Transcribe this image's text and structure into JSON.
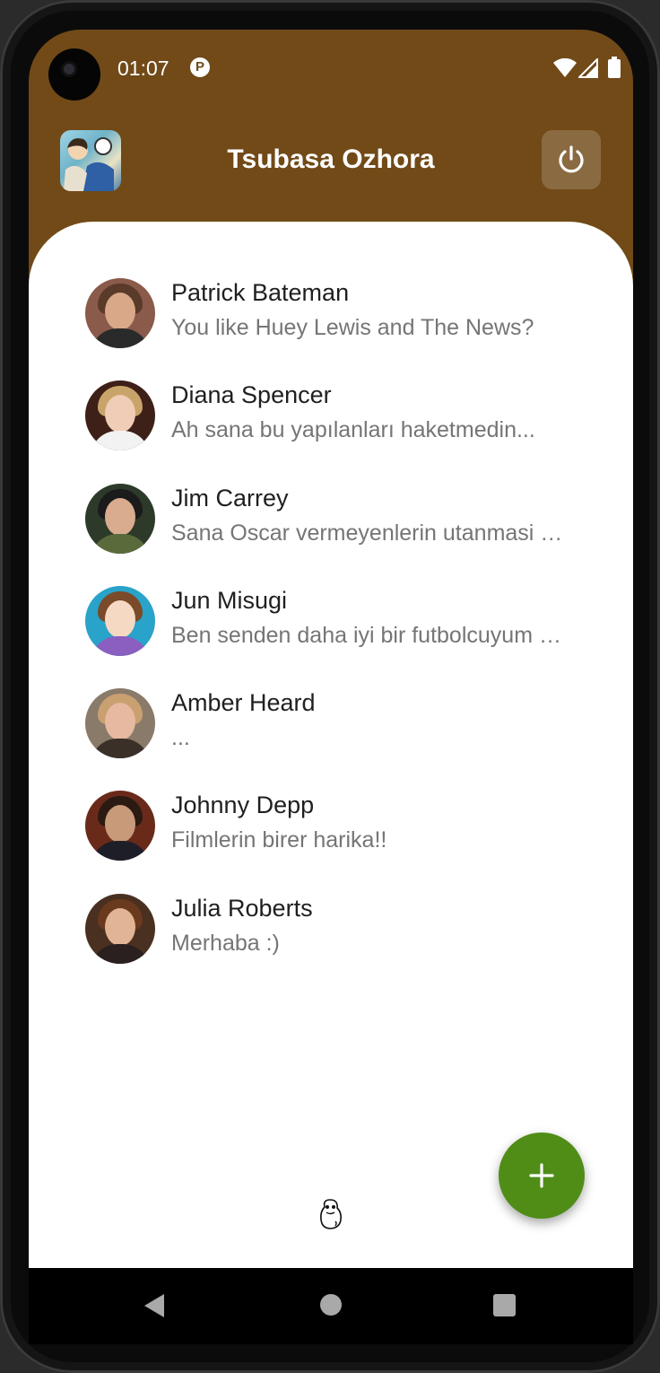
{
  "status_bar": {
    "time": "01:07",
    "app_indicator": "P"
  },
  "header": {
    "title": "Tsubasa Ozhora",
    "logo_icon": "anime-app-logo",
    "power_icon": "power-icon"
  },
  "chats": [
    {
      "name": "Patrick Bateman",
      "preview": "You like Huey Lewis and The News?"
    },
    {
      "name": "Diana Spencer",
      "preview": "Ah sana bu yapılanları haketmedin..."
    },
    {
      "name": "Jim Carrey",
      "preview": "Sana Oscar vermeyenlerin utanmasi lazim"
    },
    {
      "name": "Jun Misugi",
      "preview": "Ben senden daha iyi bir futbolcuyum aslinda"
    },
    {
      "name": "Amber Heard",
      "preview": "..."
    },
    {
      "name": "Johnny Depp",
      "preview": "Filmlerin birer harika!!"
    },
    {
      "name": "Julia Roberts",
      "preview": "Merhaba :)"
    }
  ],
  "fab": {
    "icon": "plus-icon"
  },
  "colors": {
    "header_brown": "#714a18",
    "fab_green": "#4f8d17",
    "name_text": "#1f1f1f",
    "preview_text": "#757575"
  }
}
